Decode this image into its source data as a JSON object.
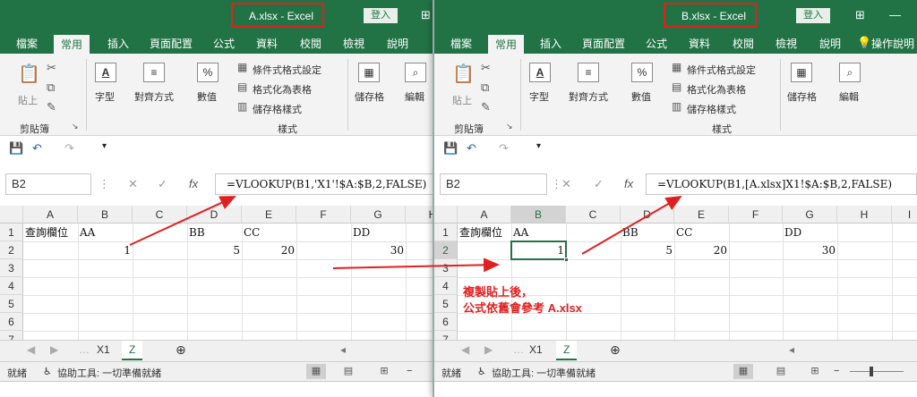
{
  "winA": {
    "title": "A.xlsx  -  Excel",
    "login": "登入",
    "tabs": [
      "檔案",
      "常用",
      "插入",
      "頁面配置",
      "公式",
      "資料",
      "校閱",
      "檢視",
      "說明"
    ],
    "ribbon": {
      "paste": "貼上",
      "clipboard": "剪貼簿",
      "font": "字型",
      "align": "對齊方式",
      "number": "數值",
      "cond_format": "條件式格式設定",
      "format_table": "格式化為表格",
      "cell_styles": "儲存格樣式",
      "styles": "樣式",
      "cells": "儲存格",
      "edit": "編輯"
    },
    "name_box": "B2",
    "formula": "=VLOOKUP(B1,'X1'!$A:$B,2,FALSE)",
    "columns": [
      "A",
      "B",
      "C",
      "D",
      "E",
      "F",
      "G",
      "H"
    ],
    "rows": [
      "1",
      "2",
      "3",
      "4",
      "5",
      "6",
      "7"
    ],
    "cells": {
      "a1": "查詢欄位",
      "b1": "AA",
      "d1": "BB",
      "e1": "CC",
      "g1": "DD",
      "b2": "1",
      "d2": "5",
      "e2": "20",
      "g2": "30"
    },
    "sheets": [
      "X1",
      "Z"
    ],
    "status": {
      "ready": "就緒",
      "access": "協助工具: 一切準備就緒"
    }
  },
  "winB": {
    "title": "B.xlsx  -  Excel",
    "login": "登入",
    "tabs": [
      "檔案",
      "常用",
      "插入",
      "頁面配置",
      "公式",
      "資料",
      "校閱",
      "檢視",
      "說明",
      "操作說明"
    ],
    "ribbon": {
      "paste": "貼上",
      "clipboard": "剪貼簿",
      "font": "字型",
      "align": "對齊方式",
      "number": "數值",
      "cond_format": "條件式格式設定",
      "format_table": "格式化為表格",
      "cell_styles": "儲存格樣式",
      "styles": "樣式",
      "cells": "儲存格",
      "edit": "編輯"
    },
    "name_box": "B2",
    "formula": "=VLOOKUP(B1,[A.xlsx]X1!$A:$B,2,FALSE)",
    "columns": [
      "A",
      "B",
      "C",
      "D",
      "E",
      "F",
      "G",
      "H",
      "I"
    ],
    "rows": [
      "1",
      "2",
      "3",
      "4",
      "5",
      "6",
      "7"
    ],
    "cells": {
      "a1": "查詢欄位",
      "b1": "AA",
      "d1": "BB",
      "e1": "CC",
      "g1": "DD",
      "b2": "1",
      "d2": "5",
      "e2": "20",
      "g2": "30"
    },
    "sheets": [
      "X1",
      "Z"
    ],
    "status": {
      "ready": "就緒",
      "access": "協助工具: 一切準備就緒"
    }
  },
  "annotation": {
    "line1": "複製貼上後，",
    "line2": "公式依舊會參考 A.xlsx"
  },
  "colors": {
    "excel_green": "#217346",
    "highlight_red": "#e02020"
  }
}
